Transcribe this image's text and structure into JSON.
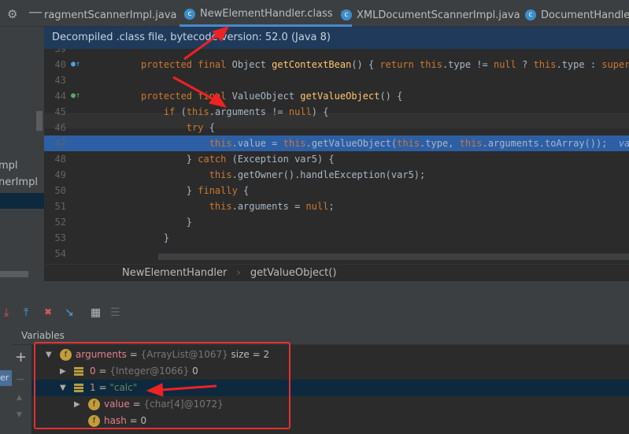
{
  "tabs": [
    {
      "label": "ragmentScannerImpl.java",
      "active": false
    },
    {
      "label": "NewElementHandler.class",
      "active": true
    },
    {
      "label": "XMLDocumentScannerImpl.java",
      "active": false
    },
    {
      "label": "DocumentHandler.c",
      "active": false
    }
  ],
  "info_bar": "Decompiled .class file, bytecode version: 52.0 (Java 8)",
  "sidebar": [
    "mpl",
    "nerImpl"
  ],
  "code_lines": [
    {
      "n": "39",
      "html": ""
    },
    {
      "n": "40",
      "parts": [
        [
          "k",
          "protected final "
        ],
        [
          "",
          "Object "
        ],
        [
          "f",
          "getContextBean"
        ],
        [
          "",
          "() { "
        ],
        [
          "k",
          "return this"
        ],
        [
          "",
          ".type != "
        ],
        [
          "k",
          "null"
        ],
        [
          "",
          " ? "
        ],
        [
          "k",
          "this"
        ],
        [
          "",
          ".type : "
        ],
        [
          "k",
          "super"
        ],
        [
          "",
          ".ge"
        ]
      ]
    },
    {
      "n": "43",
      "parts": []
    },
    {
      "n": "44",
      "parts": [
        [
          "k",
          "protected final "
        ],
        [
          "",
          "ValueObject "
        ],
        [
          "f",
          "getValueObject"
        ],
        [
          "",
          "() {"
        ]
      ]
    },
    {
      "n": "45",
      "parts": [
        [
          "",
          "    "
        ],
        [
          "k",
          "if "
        ],
        [
          "",
          "("
        ],
        [
          "k",
          "this"
        ],
        [
          "",
          ".arguments != "
        ],
        [
          "k",
          "null"
        ],
        [
          "",
          ") {"
        ]
      ]
    },
    {
      "n": "46",
      "parts": [
        [
          "",
          "        "
        ],
        [
          "k",
          "try "
        ],
        [
          "",
          "{"
        ]
      ]
    },
    {
      "n": "47",
      "parts": [
        [
          "",
          "            "
        ],
        [
          "k",
          "this"
        ],
        [
          "",
          ".value = "
        ],
        [
          "k",
          "this"
        ],
        [
          "",
          ".getValueObject("
        ],
        [
          "k",
          "this"
        ],
        [
          "",
          ".type, "
        ],
        [
          "k",
          "this"
        ],
        [
          "",
          ".arguments.toArray());  "
        ],
        [
          "hint",
          "value"
        ]
      ]
    },
    {
      "n": "48",
      "parts": [
        [
          "",
          "        } "
        ],
        [
          "k",
          "catch "
        ],
        [
          "",
          "(Exception var5) {"
        ]
      ]
    },
    {
      "n": "49",
      "parts": [
        [
          "",
          "            "
        ],
        [
          "k",
          "this"
        ],
        [
          "",
          ".getOwner().handleException(var5);"
        ]
      ]
    },
    {
      "n": "50",
      "parts": [
        [
          "",
          "        } "
        ],
        [
          "k",
          "finally "
        ],
        [
          "",
          "{"
        ]
      ]
    },
    {
      "n": "51",
      "parts": [
        [
          "",
          "            "
        ],
        [
          "k",
          "this"
        ],
        [
          "",
          ".arguments = "
        ],
        [
          "k",
          "null"
        ],
        [
          "",
          ";"
        ]
      ]
    },
    {
      "n": "52",
      "parts": [
        [
          "",
          "        }"
        ]
      ]
    },
    {
      "n": "53",
      "parts": [
        [
          "",
          "    }"
        ]
      ]
    },
    {
      "n": "54",
      "parts": []
    }
  ],
  "breadcrumb": [
    "NewElementHandler",
    "getValueObject()"
  ],
  "variables_title": "Variables",
  "variables": [
    {
      "name": "arguments",
      "eq": " = ",
      "type": "{ArrayList@1067}",
      "val": "  size = 2",
      "icon": "field",
      "expanded": true,
      "depth": 0
    },
    {
      "name": "0",
      "eq": " = ",
      "type": "{Integer@1066}",
      "val": " 0",
      "icon": "list-item",
      "expanded": false,
      "depth": 1
    },
    {
      "name": "1",
      "eq": " = ",
      "type": "",
      "val": "\"calc\"",
      "icon": "list-item",
      "expanded": true,
      "depth": 1,
      "selected": true
    },
    {
      "name": "value",
      "eq": " = ",
      "type": "{char[4]@1072}",
      "val": "",
      "icon": "field",
      "expanded": false,
      "depth": 2
    },
    {
      "name": "hash",
      "eq": " = ",
      "type": "",
      "val": "0",
      "icon": "field",
      "leaf": true,
      "depth": 2
    }
  ],
  "colors": {
    "keyword": "#cc7832",
    "method": "#ffc66d",
    "highlight": "#2d5fa5",
    "annotation": "#e53030"
  }
}
